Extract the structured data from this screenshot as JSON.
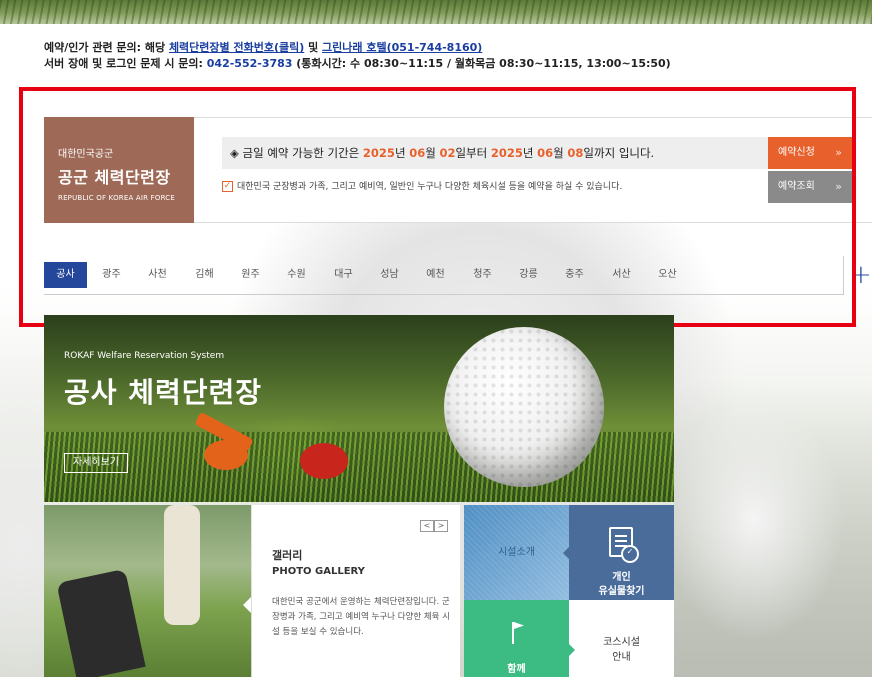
{
  "contact": {
    "line1_prefix": "예약/인가 관련 문의: 해당 ",
    "line1_link1": "체력단련장별 전화번호(클릭)",
    "line1_mid": " 및 ",
    "line1_link2": "그린나래 호텔(051-744-8160)",
    "line2_prefix": "서버 장애 및 로그인 문제 시 문의: ",
    "line2_phone": "042-552-3783",
    "line2_suffix": " (통화시간: 수 08:30~11:15 / 월화목금 08:30~11:15, 13:00~15:50)"
  },
  "logo": {
    "small": "대한민국공군",
    "big": "공군 체력단련장",
    "eng": "REPUBLIC OF KOREA AIR FORCE"
  },
  "period": {
    "prefix": "◈ 금일 예약 가능한 기간은 ",
    "start_year": "2025",
    "y_label1": "년 ",
    "start_month": "06",
    "m_label1": "월 ",
    "start_day": "02",
    "d_label1": "일부터 ",
    "end_year": "2025",
    "y_label2": "년 ",
    "end_month": "06",
    "m_label2": "월 ",
    "end_day": "08",
    "d_label2": "일까지 입니다."
  },
  "notice": "대한민국 군장병과 가족, 그리고 예비역, 일반인 누구나 다양한 체육시설 등을 예약을 하실 수 있습니다.",
  "buttons": {
    "reserve": "예약신청",
    "inquiry": "예약조회",
    "arrow": "»"
  },
  "tabs": [
    "공사",
    "광주",
    "사천",
    "김해",
    "원주",
    "수원",
    "대구",
    "성남",
    "예천",
    "청주",
    "강릉",
    "충주",
    "서산",
    "오산"
  ],
  "plus": "+",
  "banner": {
    "sub": "ROKAF Welfare Reservation System",
    "title": "공사 체력단련장",
    "more": "자세히보기"
  },
  "gallery": {
    "prev": "<",
    "next": ">",
    "title": "갤러리",
    "subtitle": "PHOTO GALLERY",
    "desc": "대한민국 공군에서 운영하는 체력단련장입니다. 군장병과 가족, 그리고 예비역 누구나 다양한 체육 시설 등을 보실 수 있습니다."
  },
  "tiles": {
    "facility": "시설소개",
    "lost_l1": "개인",
    "lost_l2": "유실물찾기",
    "together": "함께",
    "course_l1": "코스시설",
    "course_l2": "안내"
  },
  "colors": {
    "accent_orange": "#e8602c",
    "tab_active": "#24479b",
    "logo_bg": "#9e6a57",
    "highlight_red": "#e60012"
  }
}
